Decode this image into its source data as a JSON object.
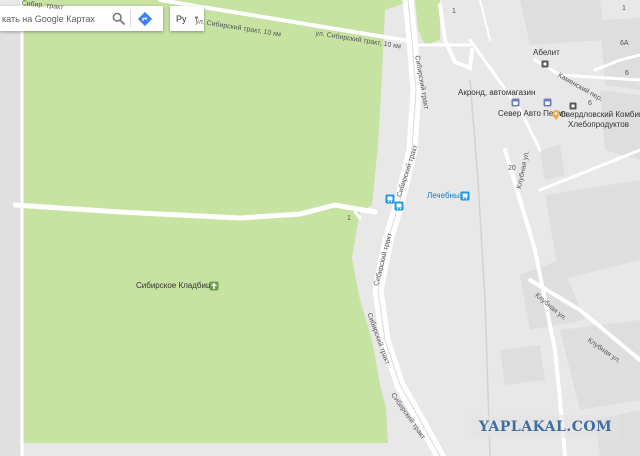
{
  "search": {
    "placeholder": "кать на Google Картах"
  },
  "language": {
    "value": "Ру"
  },
  "icons": {
    "search": "search-icon",
    "directions": "directions-icon",
    "dropdown": "dropdown-caret-icon",
    "cemetery": "cemetery-icon",
    "bus": "bus-stop-icon",
    "shop": "shop-icon",
    "poi": "poi-dot-icon"
  },
  "labels": {
    "cemetery": "Сибирское Кладбище",
    "abelit": "Абелит",
    "akrond": "Акронд, автомагазин",
    "sever_avto": "Север Авто Пермь",
    "sverdlovsky": "Свердловский Комбинат",
    "khleboproduktov": "Хлебопродуктов",
    "lechebny": "Лечебный"
  },
  "streets": {
    "sib_trakt_10km_a": "ул. Сибирский тракт, 10 км",
    "sib_trakt_10km_b": "ул. Сибирский тракт, 10 км",
    "sib_trakt_1": "Сибирский тракт",
    "sib_trakt_2": "Сибирский тракт",
    "sib_trakt_3": "Сибирский тракт",
    "sib_trakt_4": "Сибирский тракт",
    "sib_trakt_5": "Сибирский тракт",
    "klubnaya_1": "Клубная ул.",
    "klubnaya_2": "Клубная ул.",
    "klubnaya_3": "Клубная ул.",
    "kamensky_per": "Каменский пер.",
    "top_left": "Сибир. тракт"
  },
  "house_numbers": {
    "n1": "1",
    "n2": "1",
    "n3": "6",
    "n4": "6А",
    "n5": "6",
    "n6": "20",
    "n7": "1"
  },
  "watermark": "YAPLAKAL.COM",
  "colors": {
    "park": "#c6e3a1",
    "land": "#e8e8e8",
    "road": "#ffffff",
    "bus_icon": "#1a9be8",
    "shop_icon": "#6f7ec4",
    "watermark": "#3f6ea3"
  }
}
